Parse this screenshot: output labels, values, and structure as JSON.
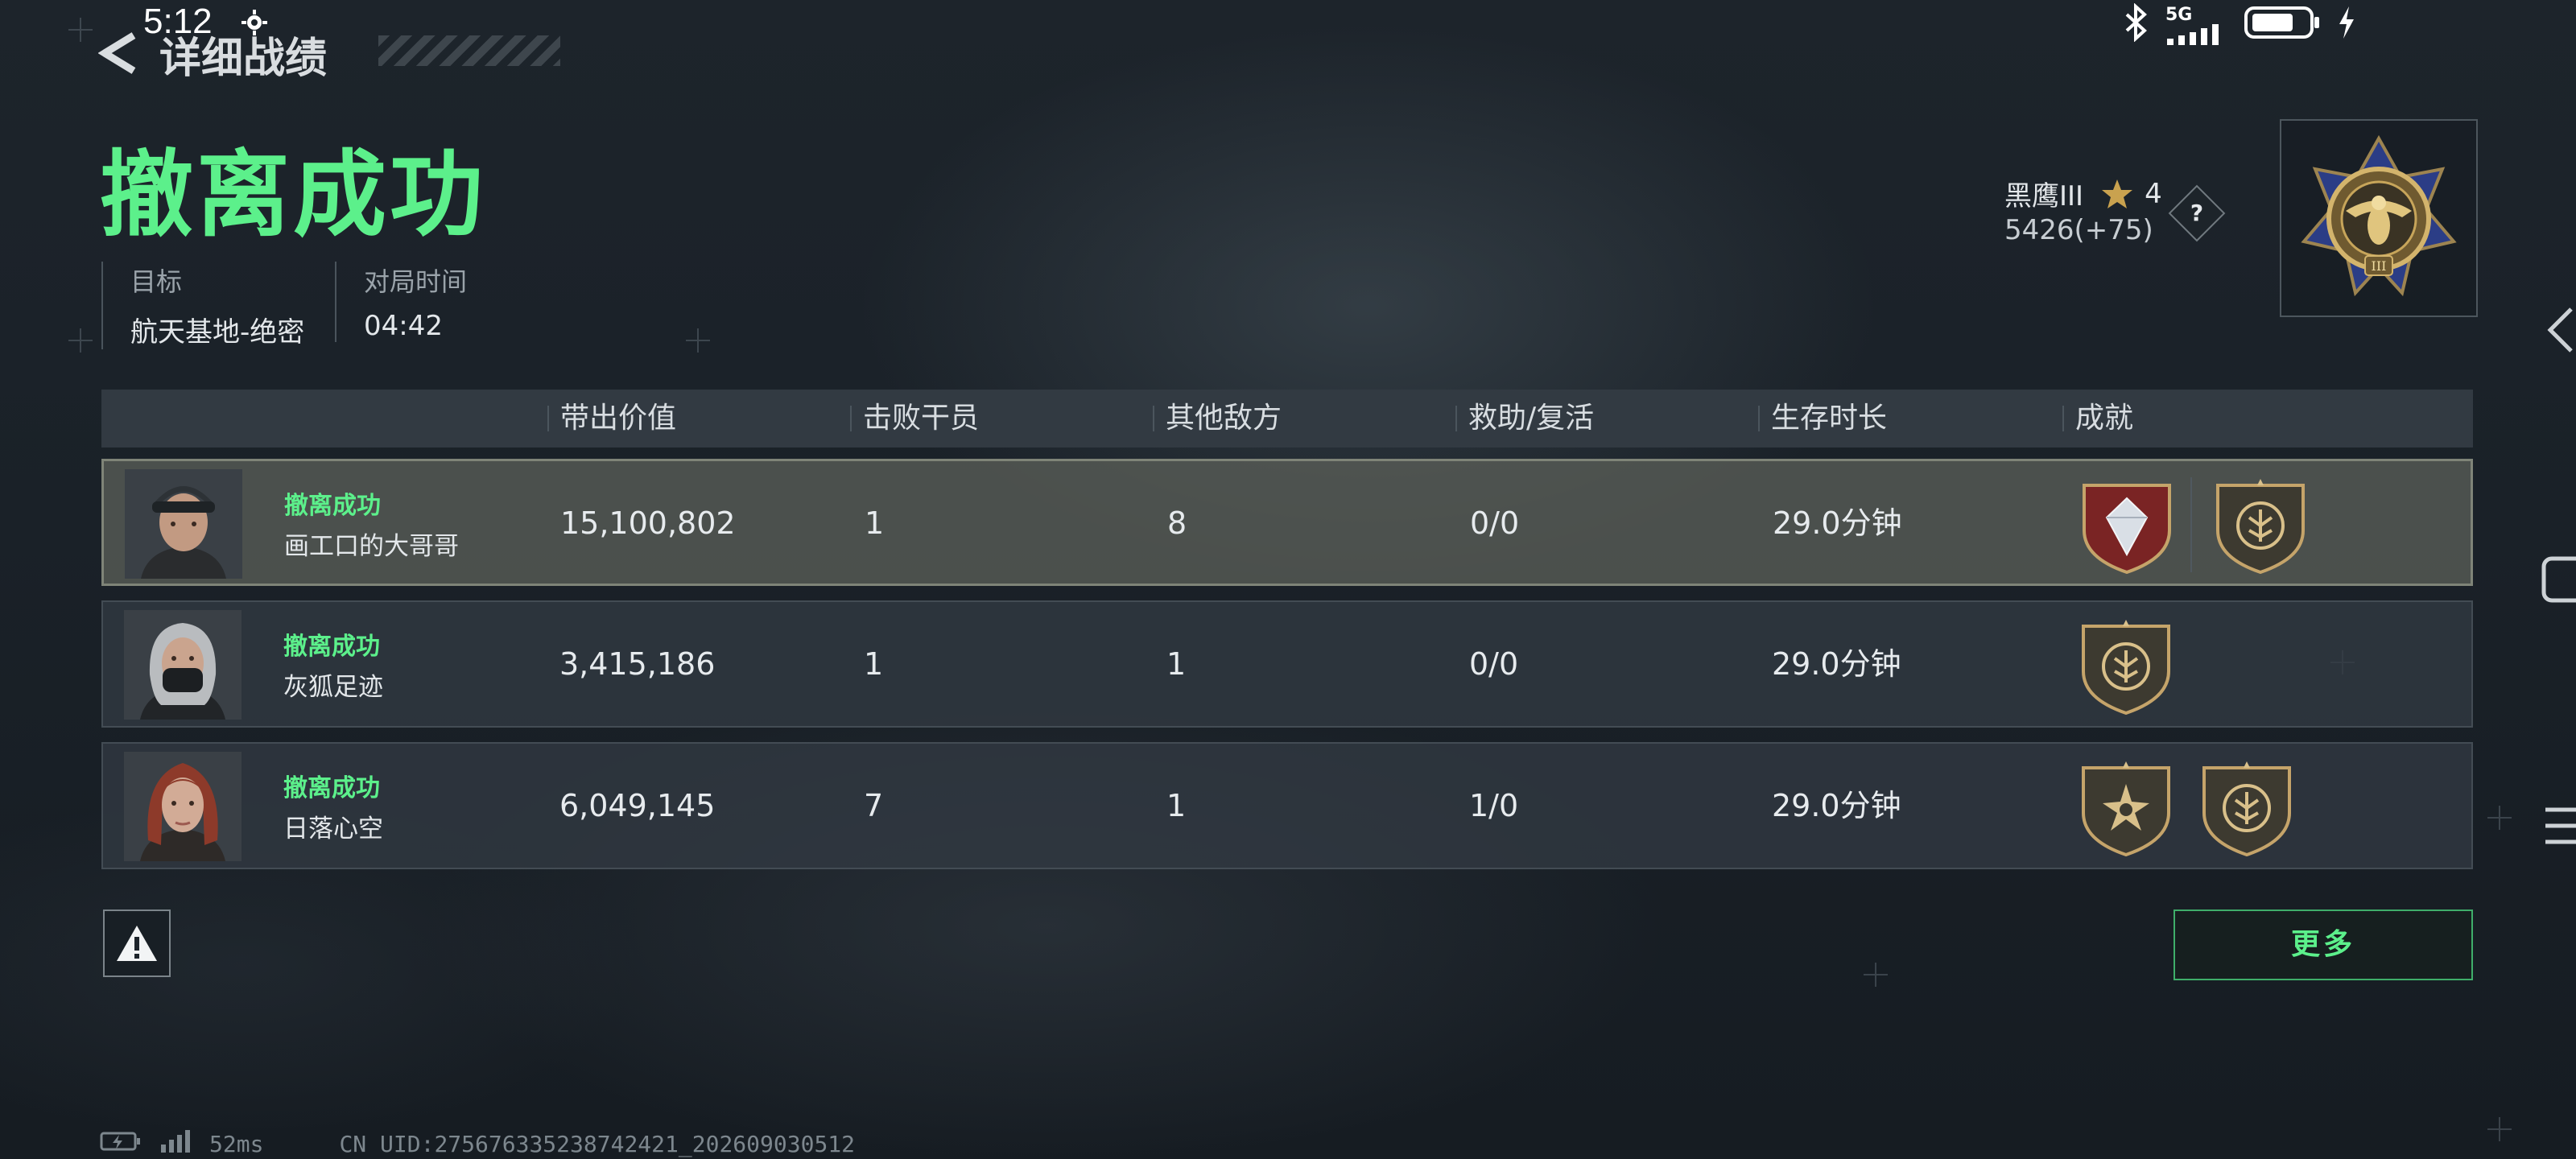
{
  "status_bar": {
    "time": "5:12",
    "network": "5G"
  },
  "header": {
    "back_title": "详细战绩",
    "result_title": "撤离成功"
  },
  "match_info": [
    {
      "label": "目标",
      "value": "航天基地-绝密"
    },
    {
      "label": "对局时间",
      "value": "04:42"
    }
  ],
  "rank": {
    "name": "黑鹰III",
    "stars": "4",
    "score": "5426(+75)",
    "help": "?",
    "medal_level": "III"
  },
  "table": {
    "columns": [
      "带出价值",
      "击败干员",
      "其他敌方",
      "救助/复活",
      "生存时长",
      "成就"
    ],
    "rows": [
      {
        "status": "撤离成功",
        "name": "画工口的大哥哥",
        "value": "15,100,802",
        "kills": "1",
        "other": "8",
        "assist": "0/0",
        "survival": "29.0分钟",
        "badges": [
          "diamond-badge",
          "wings-badge"
        ]
      },
      {
        "status": "撤离成功",
        "name": "灰狐足迹",
        "value": "3,415,186",
        "kills": "1",
        "other": "1",
        "assist": "0/0",
        "survival": "29.0分钟",
        "badges": [
          "wings-badge"
        ]
      },
      {
        "status": "撤离成功",
        "name": "日落心空",
        "value": "6,049,145",
        "kills": "7",
        "other": "1",
        "assist": "1/0",
        "survival": "29.0分钟",
        "badges": [
          "star-burst-badge",
          "wings-badge"
        ]
      }
    ]
  },
  "buttons": {
    "more": "更多"
  },
  "footer": {
    "ping": "52ms",
    "uid": "CN UID:275676335238742421_202609030512"
  },
  "colors": {
    "accent_green": "#5cf08b",
    "background": "#1a2128"
  }
}
